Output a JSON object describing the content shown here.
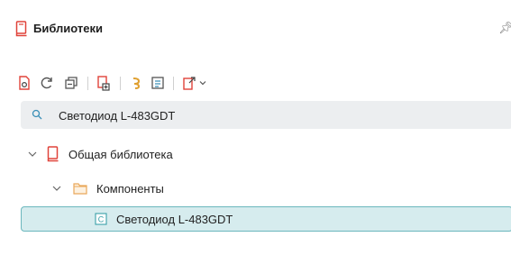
{
  "panel": {
    "title": "Библиотеки"
  },
  "search": {
    "value": "Светодиод L-483GDT",
    "placeholder": ""
  },
  "tree": {
    "library": "Общая библиотека",
    "folder": "Компоненты",
    "component": "Светодиод L-483GDT"
  },
  "colors": {
    "accent": "#e0433a",
    "selection_bg": "#d6ecee",
    "selection_border": "#6bb7bd",
    "search_bg": "#eceef0",
    "folder": "#e9a85a"
  },
  "icons": {
    "header": "book-icon",
    "toolbar": [
      "new-library-icon",
      "refresh-icon",
      "collapse-icon",
      "add-component-icon",
      "link-icon",
      "properties-icon",
      "export-icon",
      "dropdown-chevron-icon"
    ]
  }
}
